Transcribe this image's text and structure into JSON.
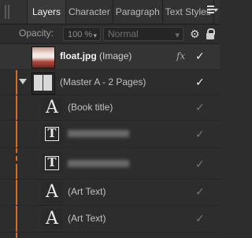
{
  "tabs": [
    {
      "label": "Layers"
    },
    {
      "label": "Character"
    },
    {
      "label": "Paragraph"
    },
    {
      "label": "Text Styles"
    }
  ],
  "options": {
    "opacity_label": "Opacity:",
    "opacity_value": "100 %",
    "blend_mode": "Normal"
  },
  "layers": [
    {
      "name": "float.jpg",
      "suffix": "(Image)",
      "fx": "fx",
      "visible": true
    },
    {
      "name": "(Master A - 2 Pages)",
      "visible": true
    },
    {
      "name": "(Book title)",
      "visible": true
    },
    {
      "name": "",
      "visible": true
    },
    {
      "name": "",
      "visible": true
    },
    {
      "name": "(Art Text)",
      "visible": true
    },
    {
      "name": "(Art Text)",
      "visible": true
    }
  ],
  "colors": {
    "accent": "#e06a1f",
    "panel_bg": "#2d2d2d"
  },
  "icons": {
    "panel_menu": "hamburger-menu-icon",
    "settings": "gear-icon",
    "lock": "lock-icon",
    "visibility": "checkmark-icon"
  }
}
